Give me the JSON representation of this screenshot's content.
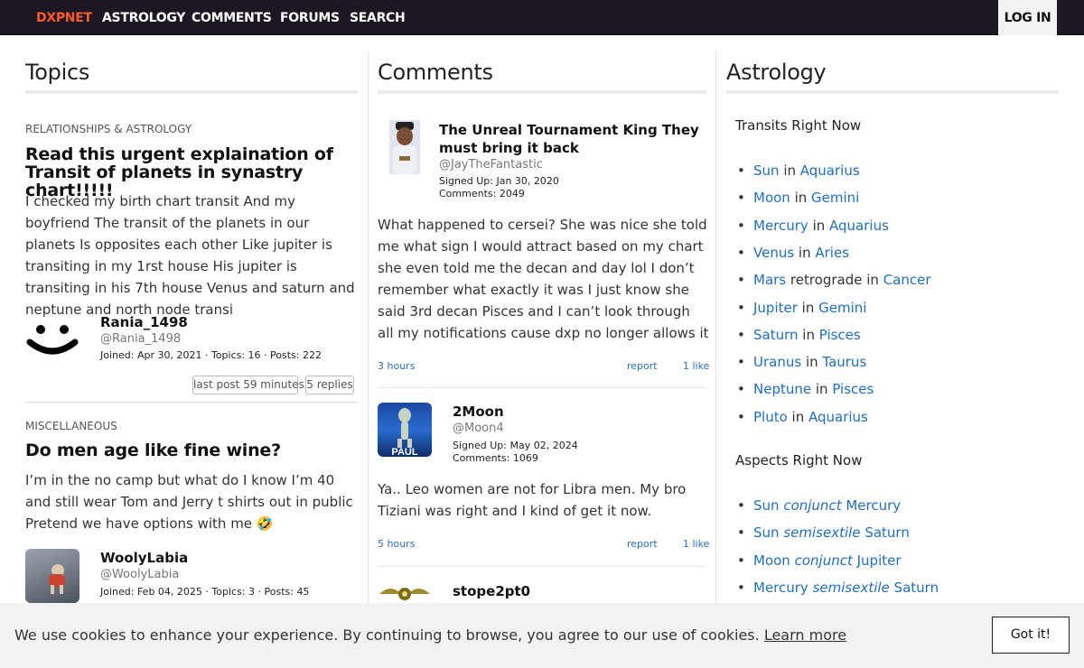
{
  "nav": {
    "brand": "DXPNET",
    "links": [
      "ASTROLOGY",
      "COMMENTS",
      "FORUMS",
      "SEARCH"
    ],
    "login": "LOG IN",
    "colors": {
      "bar": "#1c1723",
      "brand": "#ff5a2b"
    }
  },
  "topics": {
    "heading": "Topics",
    "items": [
      {
        "category": "RELATIONSHIPS & ASTROLOGY",
        "title": "Read this urgent explaination of Transit of planets in synastry chart!!!!!",
        "body": "I checked my birth chart transit And my boyfriend The transit of the planets in our planets Is opposites each other Like jupiter is transiting in my 1rst house His jupiter is transiting in his 7th house Venus and saturn and neptune and north node transi",
        "user": "Rania_1498",
        "handle": "@Rania_1498",
        "stats": "Joined: Apr 30, 2021 · Topics: 16 · Posts: 222",
        "avatar": "smiley-avatar",
        "last_post": "last post 59 minutes",
        "replies": "5 replies"
      },
      {
        "category": "MISCELLANEOUS",
        "title": "Do men age like fine wine?",
        "body": "I’m in the no camp but what do I know I’m 40 and still wear Tom and Jerry t shirts out in public Pretend we have options with me",
        "emoji": "🤣",
        "user": "WoolyLabia",
        "handle": "@WoolyLabia",
        "stats": "Joined: Feb 04, 2025 · Topics: 3 · Posts: 45",
        "avatar": "photo-avatar"
      }
    ]
  },
  "comments": {
    "heading": "Comments",
    "items": [
      {
        "title": "The Unreal Tournament King They must bring it back",
        "handle": "@JayTheFantastic",
        "signed_up": "Signed Up: Jan 30, 2020",
        "count": "Comments: 2049",
        "body": "What happened to cersei? She was nice she told me what sign I would attract based on my chart she even told me the decan and day lol I don’t remember what exactly it was I just know she said 3rd decan Pisces and I can’t look through all my notifications cause dxp no longer allows it",
        "time": "3 hours",
        "report": "report",
        "likes": "1 like"
      },
      {
        "user": "2Moon",
        "handle": "@Moon4",
        "signed_up": "Signed Up: May 02, 2024",
        "count": "Comments: 1069",
        "poster_text": "PAUL",
        "body": "Ya.. Leo women are not for Libra men. My bro Tiziani was right and I kind of get it now.",
        "time": "5 hours",
        "report": "report",
        "likes": "1 like"
      },
      {
        "user": "stope2pt0"
      }
    ]
  },
  "astrology": {
    "heading": "Astrology",
    "transits_heading": "Transits Right Now",
    "transits": [
      {
        "planet": "Sun",
        "mid": " in ",
        "sign": "Aquarius"
      },
      {
        "planet": "Moon",
        "mid": " in ",
        "sign": "Gemini"
      },
      {
        "planet": "Mercury",
        "mid": " in ",
        "sign": "Aquarius"
      },
      {
        "planet": "Venus",
        "mid": " in ",
        "sign": "Aries"
      },
      {
        "planet": "Mars",
        "mid": " retrograde in ",
        "sign": "Cancer"
      },
      {
        "planet": "Jupiter",
        "mid": " in ",
        "sign": "Gemini"
      },
      {
        "planet": "Saturn",
        "mid": " in ",
        "sign": "Pisces"
      },
      {
        "planet": "Uranus",
        "mid": " in ",
        "sign": "Taurus"
      },
      {
        "planet": "Neptune",
        "mid": " in ",
        "sign": "Pisces"
      },
      {
        "planet": "Pluto",
        "mid": " in ",
        "sign": "Aquarius"
      }
    ],
    "aspects_heading": "Aspects Right Now",
    "aspects": [
      {
        "a": "Sun",
        "aspect": "conjunct",
        "b": "Mercury"
      },
      {
        "a": "Sun",
        "aspect": "semisextile",
        "b": "Saturn"
      },
      {
        "a": "Moon",
        "aspect": "conjunct",
        "b": "Jupiter"
      },
      {
        "a": "Mercury",
        "aspect": "semisextile",
        "b": "Saturn"
      }
    ]
  },
  "cookie": {
    "text": "We use cookies to enhance your experience. By continuing to browse, you agree to our use of cookies.",
    "link": "Learn more",
    "button": "Got it!"
  }
}
